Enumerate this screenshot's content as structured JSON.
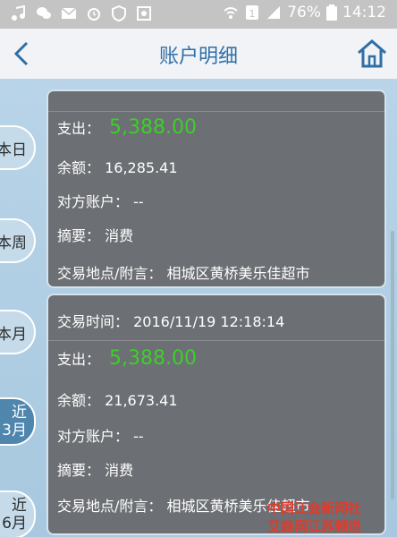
{
  "status_bar": {
    "battery": "76%",
    "time": "14:12",
    "icons": [
      "music-icon",
      "wechat-icon",
      "mail-icon",
      "alarm-icon",
      "shield-icon",
      "image-icon"
    ]
  },
  "header": {
    "title": "账户明细"
  },
  "periods": [
    {
      "label": "本日",
      "active": false
    },
    {
      "label": "本周",
      "active": false
    },
    {
      "label": "本月",
      "active": false
    },
    {
      "label": "近3月",
      "line1": "近",
      "line2": "3月",
      "active": true
    },
    {
      "label": "近6月",
      "line1": "近",
      "line2": "6月",
      "active": false
    }
  ],
  "transactions": [
    {
      "expense_label": "支出：",
      "expense": "5,388.00",
      "balance_label": "余额：",
      "balance": "16,285.41",
      "counterparty_label": "对方账户：",
      "counterparty": "--",
      "summary_label": "摘要：",
      "summary": "消费",
      "location_label": "交易地点/附言：",
      "location": "相城区黄桥美乐佳超市"
    },
    {
      "time_label": "交易时间：",
      "time": "2016/11/19 12:18:14",
      "expense_label": "支出：",
      "expense": "5,388.00",
      "balance_label": "余额：",
      "balance": "21,673.41",
      "counterparty_label": "对方账户：",
      "counterparty": "--",
      "summary_label": "摘要：",
      "summary": "消费",
      "location_label": "交易地点/附言：",
      "location": "相城区黄桥美乐佳超市"
    }
  ],
  "watermark": {
    "line1": "中国江会新闻社",
    "line2": "艾森网江苏频道"
  },
  "colors": {
    "amount": "#3ccf2a",
    "accent": "#2f6fa6",
    "card": "#6c6f73"
  },
  "chart_data": {
    "type": "table",
    "columns": [
      "交易时间",
      "支出",
      "余额",
      "对方账户",
      "摘要",
      "交易地点/附言"
    ],
    "rows": [
      [
        "",
        "5,388.00",
        "16,285.41",
        "--",
        "消费",
        "相城区黄桥美乐佳超市"
      ],
      [
        "2016/11/19 12:18:14",
        "5,388.00",
        "21,673.41",
        "--",
        "消费",
        "相城区黄桥美乐佳超市"
      ]
    ]
  }
}
